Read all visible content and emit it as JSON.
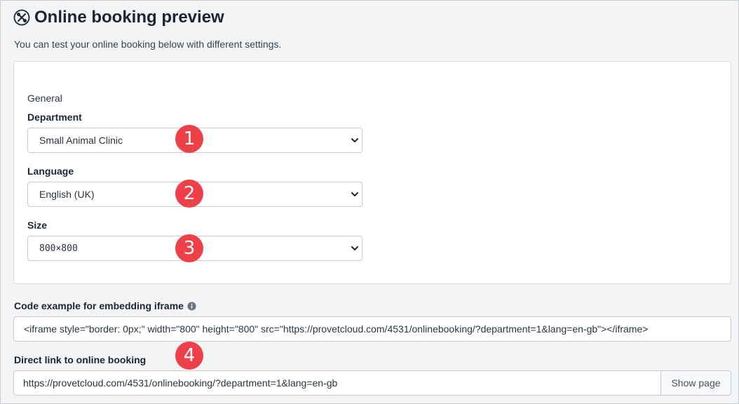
{
  "header": {
    "title": "Online booking preview",
    "subtitle": "You can test your online booking below with different settings.",
    "icon": "tools-icon"
  },
  "general": {
    "section_label": "General",
    "department": {
      "label": "Department",
      "value": "Small Animal Clinic"
    },
    "language": {
      "label": "Language",
      "value": "English (UK)"
    },
    "size": {
      "label": "Size",
      "value": "800×800"
    }
  },
  "markers": [
    "1",
    "2",
    "3",
    "4"
  ],
  "embed": {
    "label": "Code example for embedding iframe",
    "code": "<iframe style=\"border: 0px;\" width=\"800\" height=\"800\" src=\"https://provetcloud.com/4531/onlinebooking/?department=1&lang=en-gb\"></iframe>"
  },
  "direct_link": {
    "label": "Direct link to online booking",
    "url": "https://provetcloud.com/4531/onlinebooking/?department=1&lang=en-gb",
    "button_label": "Show page"
  },
  "colors": {
    "marker": "#ee4048",
    "title": "#1b2536"
  }
}
